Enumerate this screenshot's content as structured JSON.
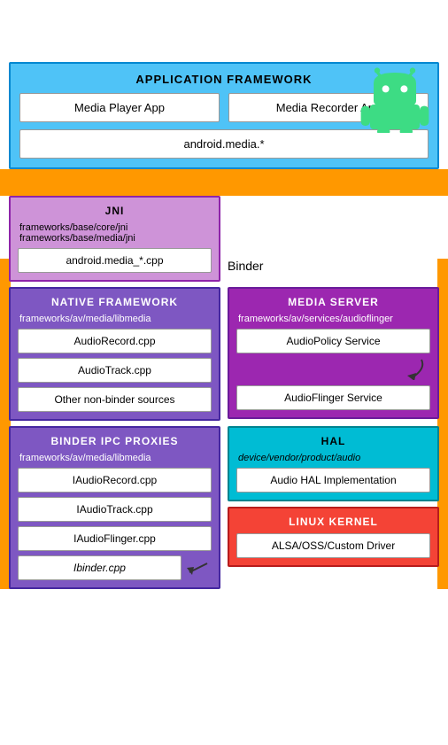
{
  "android_robot": {
    "label": "Android Robot"
  },
  "app_framework": {
    "title": "APPLICATION FRAMEWORK",
    "media_player": "Media Player App",
    "media_recorder": "Media Recorder App",
    "android_media": "android.media.*"
  },
  "jni": {
    "title": "JNI",
    "path1": "frameworks/base/core/jni",
    "path2": "frameworks/base/media/jni",
    "file": "android.media_*.cpp"
  },
  "binder": {
    "label": "Binder"
  },
  "native_framework": {
    "title": "NATIVE FRAMEWORK",
    "path": "frameworks/av/media/libmedia",
    "files": [
      "AudioRecord.cpp",
      "AudioTrack.cpp",
      "Other non-binder sources"
    ]
  },
  "media_server": {
    "title": "MEDIA SERVER",
    "path": "frameworks/av/services/audioflinger",
    "files": [
      "AudioPolicy Service",
      "AudioFlinger Service"
    ]
  },
  "binder_ipc": {
    "title": "BINDER IPC PROXIES",
    "path": "frameworks/av/media/libmedia",
    "files": [
      "IAudioRecord.cpp",
      "IAudioTrack.cpp",
      "IAudioFlinger.cpp",
      "Ibinder.cpp"
    ]
  },
  "hal": {
    "title": "HAL",
    "path": "device/vendor/product/audio",
    "files": [
      "Audio HAL Implementation"
    ]
  },
  "linux_kernel": {
    "title": "LINUX KERNEL",
    "files": [
      "ALSA/OSS/Custom Driver"
    ]
  }
}
